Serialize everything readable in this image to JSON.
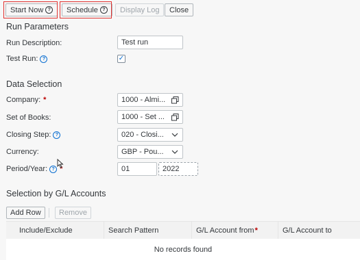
{
  "toolbar": {
    "start_now": "Start Now",
    "schedule": "Schedule",
    "display_log": "Display Log",
    "close": "Close"
  },
  "run_parameters": {
    "title": "Run Parameters",
    "run_description_label": "Run Description:",
    "run_description_value": "Test run",
    "test_run_label": "Test Run:",
    "test_run_checked": true
  },
  "data_selection": {
    "title": "Data Selection",
    "company_label": "Company:",
    "company_value": "1000 - Almi...",
    "set_of_books_label": "Set of Books:",
    "set_of_books_value": "1000 - Set ...",
    "closing_step_label": "Closing Step:",
    "closing_step_value": "020 - Closi...",
    "currency_label": "Currency:",
    "currency_value": "GBP - Pou...",
    "period_year_label": "Period/Year:",
    "period_value": "01",
    "year_value": "2022",
    "required_marker": "*"
  },
  "gl_selection": {
    "title": "Selection by G/L Accounts",
    "add_row": "Add Row",
    "remove": "Remove",
    "columns": [
      "Include/Exclude",
      "Search Pattern",
      "G/L Account from",
      "G/L Account to"
    ],
    "empty_text": "No records found"
  },
  "colors": {
    "accent": "#0a6ed1",
    "required": "#bb0000",
    "highlight_box": "#e0312f"
  }
}
